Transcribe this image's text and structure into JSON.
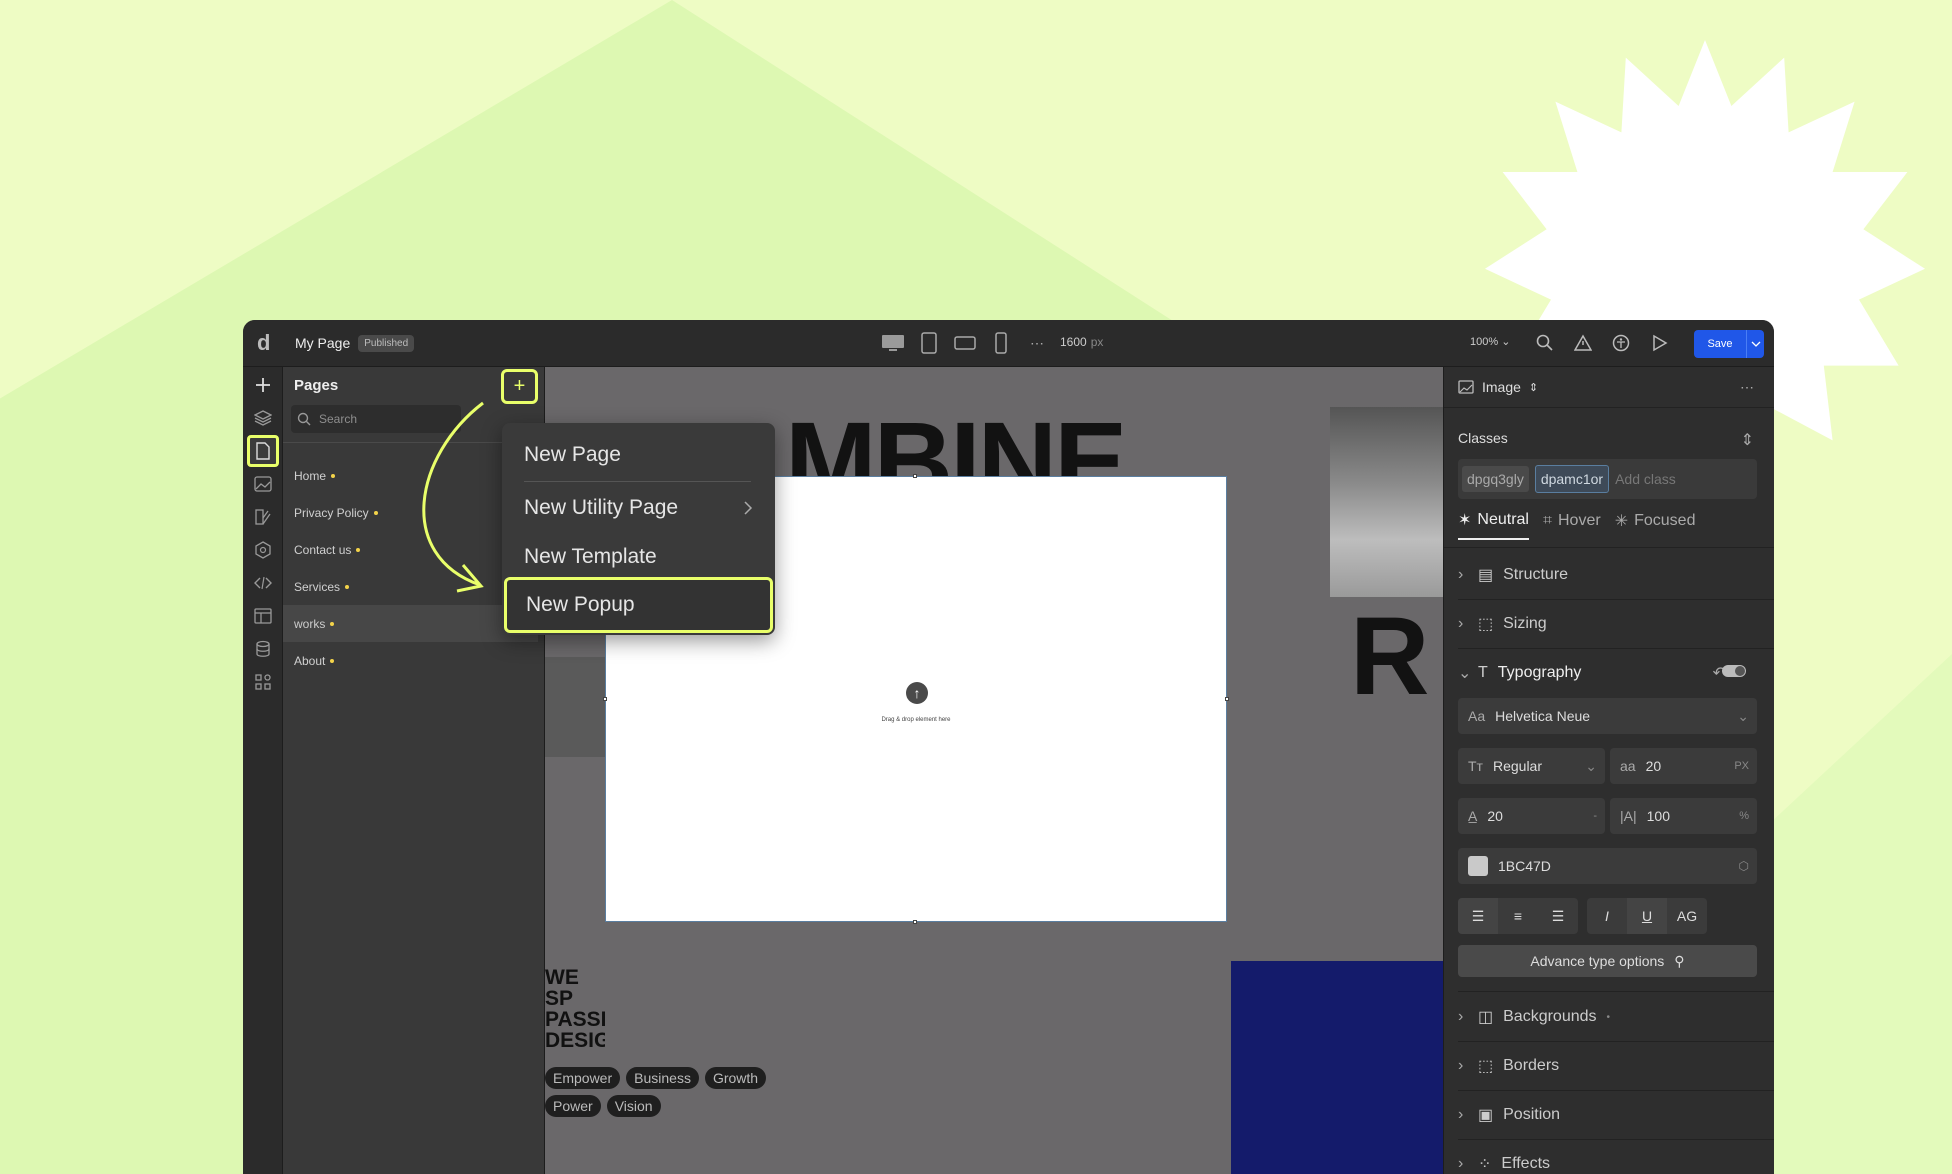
{
  "app": {
    "logo": "d",
    "page_title": "My Page",
    "status_badge": "Published",
    "width_value": "1600",
    "width_unit": "px",
    "zoom": "100%",
    "save_label": "Save",
    "accent": "#2057e8",
    "highlight": "#e9ff6a"
  },
  "pages_panel": {
    "title": "Pages",
    "add_button": "+",
    "search_placeholder": "Search",
    "items": [
      {
        "label": "Home"
      },
      {
        "label": "Privacy Policy"
      },
      {
        "label": "Contact us"
      },
      {
        "label": "Services"
      },
      {
        "label": "works"
      },
      {
        "label": "About"
      }
    ]
  },
  "add_menu": {
    "items": [
      "New Page",
      "New Utility Page",
      "New Template",
      "New Popup"
    ]
  },
  "canvas": {
    "headline_fragment": "MBINE",
    "headline_fragment_2": "R",
    "popup_hint": "Drag & drop element here",
    "left_text": [
      "WE SP",
      "PASSI",
      "DESIG"
    ],
    "tags": [
      "Empower",
      "Business",
      "Growth",
      "Power",
      "Vision"
    ]
  },
  "inspector": {
    "element_type": "Image",
    "classes_label": "Classes",
    "classes": [
      "dpgq3gly",
      "dpamc1or"
    ],
    "add_class_placeholder": "Add class",
    "states": [
      "Neutral",
      "Hover",
      "Focused"
    ],
    "sections": {
      "structure": "Structure",
      "sizing": "Sizing",
      "typography": "Typography",
      "backgrounds": "Backgrounds",
      "borders": "Borders",
      "position": "Position",
      "effects": "Effects"
    },
    "font_family": "Helvetica Neue",
    "font_prefix": "Aa",
    "font_weight": "Regular",
    "font_size": "20",
    "font_size_unit": "PX",
    "line_height": "20",
    "line_height_unit": "-",
    "letter_spacing": "100",
    "letter_spacing_unit": "%",
    "color_hex": "1BC47D",
    "italic": "I",
    "underline": "U",
    "case": "AG",
    "advanced_label": "Advance type options"
  }
}
